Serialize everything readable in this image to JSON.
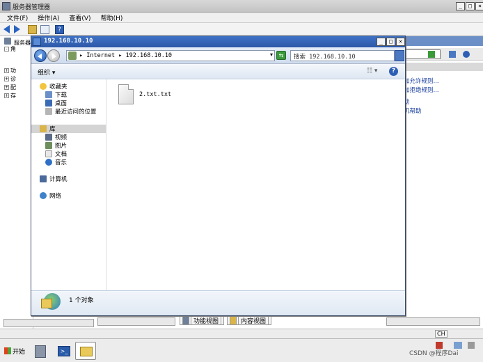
{
  "server_manager": {
    "title": "服务器管理器",
    "menu": [
      "文件(F)",
      "操作(A)",
      "查看(V)",
      "帮助(H)"
    ],
    "tree": [
      "服务器",
      "角",
      "功",
      "诊",
      "配",
      "存"
    ],
    "actions": [
      "加允许规则...",
      "加拒绝规则...",
      "动",
      "机帮助"
    ],
    "view_tabs": [
      "功能视图",
      "内容视图"
    ]
  },
  "explorer": {
    "title": "192.168.10.10",
    "address": "▸ Internet ▸ 192.168.10.10",
    "search_placeholder": "搜索 192.168.10.10",
    "organize": "组织 ▾",
    "nav": {
      "favorites": "收藏夹",
      "favorites_items": [
        "下载",
        "桌面",
        "最近访问的位置"
      ],
      "library": "库",
      "library_items": [
        "视频",
        "图片",
        "文档",
        "音乐"
      ],
      "computer": "计算机",
      "network": "网络"
    },
    "files": [
      {
        "name": "2.txt.txt"
      }
    ],
    "status": "1 个对象"
  },
  "taskbar": {
    "start_label": "开始",
    "tray_lang": "CH",
    "watermark": "CSDN @程序Dai"
  },
  "colors": {
    "title_bar": "#2c58a8",
    "link": "#1a3f9e"
  }
}
